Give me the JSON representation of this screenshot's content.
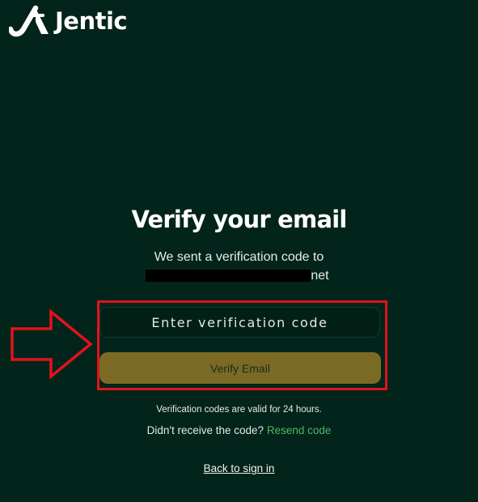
{
  "brand": {
    "name": "Jentic",
    "logo_icon": "jentic-logo-icon"
  },
  "header": {
    "title": "Verify your email"
  },
  "message": {
    "sent_line": "We sent a verification code to",
    "email_visible_suffix": "net"
  },
  "form": {
    "code_placeholder": "Enter verification code",
    "code_value": "",
    "verify_label": "Verify Email"
  },
  "footer": {
    "validity_note": "Verification codes are valid for 24 hours.",
    "resend_prompt": "Didn't receive the code?",
    "resend_label": "Resend code",
    "back_label": "Back to sign in"
  },
  "annotations": {
    "arrow_icon": "arrow-right-outline-icon",
    "highlight_color": "#e2131b"
  },
  "colors": {
    "background": "#03241b",
    "button": "#7a6a26",
    "link_green": "#51b56a"
  }
}
